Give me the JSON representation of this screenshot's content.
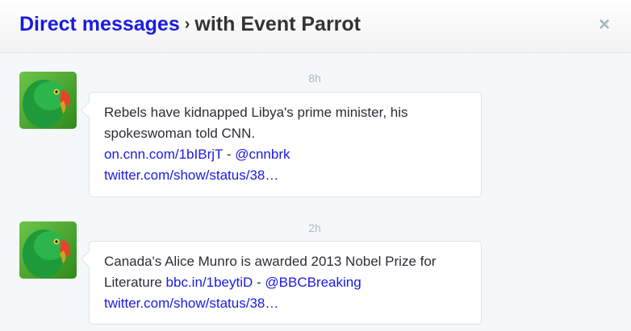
{
  "header": {
    "title_main": "Direct messages",
    "separator": "›",
    "title_sub": "with Event Parrot",
    "close_label": "×"
  },
  "messages": [
    {
      "time": "8h",
      "text_line1": "Rebels have kidnapped Libya's prime minister, his",
      "text_line2": "spokeswoman told CNN.",
      "link1": "on.cnn.com/1bIBrjT",
      "dash": " - ",
      "mention": "@cnnbrk",
      "status_link": "twitter.com/show/status/38…"
    },
    {
      "time": "2h",
      "text_line1": "Canada's Alice Munro is awarded 2013 Nobel Prize for",
      "text_line2": "Literature ",
      "link1": "bbc.in/1beytiD",
      "dash": " - ",
      "mention": "@BBCBreaking",
      "status_link": "twitter.com/show/status/38…"
    }
  ],
  "avatar_icon": "parrot-avatar",
  "colors": {
    "link": "#1a1ae0",
    "text": "#292f33",
    "muted": "#aab8c2"
  }
}
